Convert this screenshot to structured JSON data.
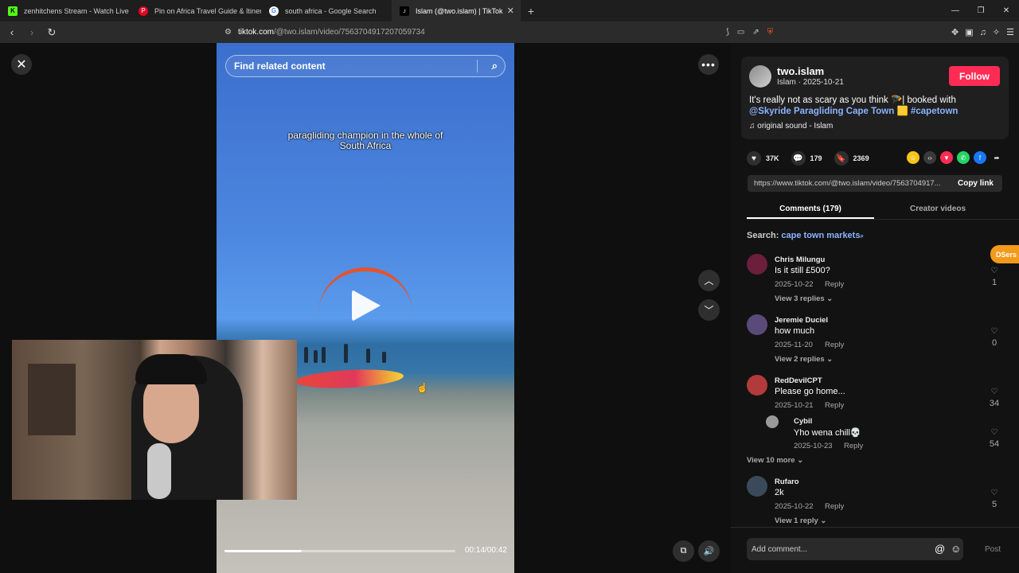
{
  "browser": {
    "tabs": [
      {
        "label": "zenhitchens Stream - Watch Live on K",
        "favicon": "K"
      },
      {
        "label": "Pin on Africa Travel Guide & Itinerari",
        "favicon": "P"
      },
      {
        "label": "south africa - Google Search",
        "favicon": "G"
      },
      {
        "label": "Islam (@two.islam) | TikTok",
        "favicon": "♪"
      }
    ],
    "url_host": "tiktok.com",
    "url_path": "/@two.islam/video/7563704917207059734"
  },
  "video": {
    "search_placeholder": "Find related content",
    "caption": "paragliding champion in the whole of South Africa",
    "time": "00:14/00:42",
    "progress": 0.333
  },
  "post": {
    "username": "two.islam",
    "subline": "Islam · 2025-10-21",
    "follow_label": "Follow",
    "desc_text": "It's really not as scary as you think ",
    "desc_emoji": "🪂",
    "desc_text2": "| booked with",
    "mention": "@Skyride Paragliding Cape Town",
    "desc_emoji2": "🟨",
    "hashtag": "#capetown",
    "sound": "original sound - Islam",
    "likes": "37K",
    "comments_count": "179",
    "saves": "2369",
    "link": "https://www.tiktok.com/@two.islam/video/7563704917...",
    "copy_label": "Copy link"
  },
  "tabs": {
    "comments": "Comments (179)",
    "creator": "Creator videos"
  },
  "search": {
    "prefix": "Search: ",
    "query": "cape town markets"
  },
  "dsers_label": "DSers",
  "comments": [
    {
      "name": "Chris Milungu",
      "text": "Is it still £500?",
      "date": "2025-10-22",
      "reply": "Reply",
      "likes": "1",
      "view": "View 3 replies ⌄"
    },
    {
      "name": "Jeremie Duciel",
      "text": "how much",
      "date": "2025-11-20",
      "reply": "Reply",
      "likes": "0",
      "view": "View 2 replies ⌄"
    },
    {
      "name": "RedDevilCPT",
      "text": "Please go home...",
      "date": "2025-10-21",
      "reply": "Reply",
      "likes": "34",
      "view": ""
    },
    {
      "name": "Cybil",
      "text": "Yho wena chill💀",
      "date": "2025-10-23",
      "reply": "Reply",
      "likes": "54",
      "view": "View 10 more ⌄"
    },
    {
      "name": "Rufaro",
      "text": "2k",
      "date": "2025-10-22",
      "reply": "Reply",
      "likes": "5",
      "view": "View 1 reply ⌄"
    }
  ],
  "add_comment_placeholder": "Add comment...",
  "post_label": "Post",
  "colors": {
    "accent": "#fe2c55",
    "link": "#8ab4ff",
    "dsers": "#f49a1a"
  }
}
